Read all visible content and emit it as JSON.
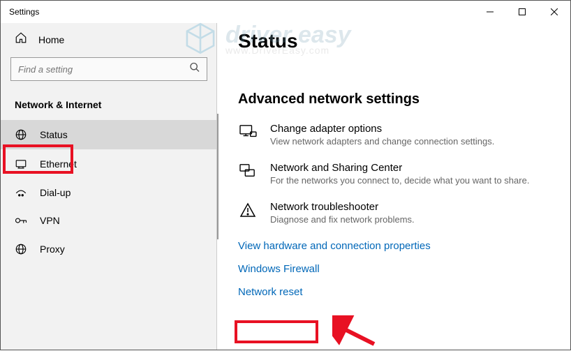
{
  "window": {
    "title": "Settings"
  },
  "sidebar": {
    "home": "Home",
    "search_placeholder": "Find a setting",
    "section": "Network & Internet",
    "items": [
      {
        "label": "Status"
      },
      {
        "label": "Ethernet"
      },
      {
        "label": "Dial-up"
      },
      {
        "label": "VPN"
      },
      {
        "label": "Proxy"
      }
    ]
  },
  "main": {
    "title": "Status",
    "adv_header": "Advanced network settings",
    "settings": [
      {
        "title": "Change adapter options",
        "desc": "View network adapters and change connection settings."
      },
      {
        "title": "Network and Sharing Center",
        "desc": "For the networks you connect to, decide what you want to share."
      },
      {
        "title": "Network troubleshooter",
        "desc": "Diagnose and fix network problems."
      }
    ],
    "links": [
      "View hardware and connection properties",
      "Windows Firewall",
      "Network reset"
    ]
  },
  "watermark": {
    "brand": "driver easy",
    "url": "www.DriverEasy.com"
  }
}
